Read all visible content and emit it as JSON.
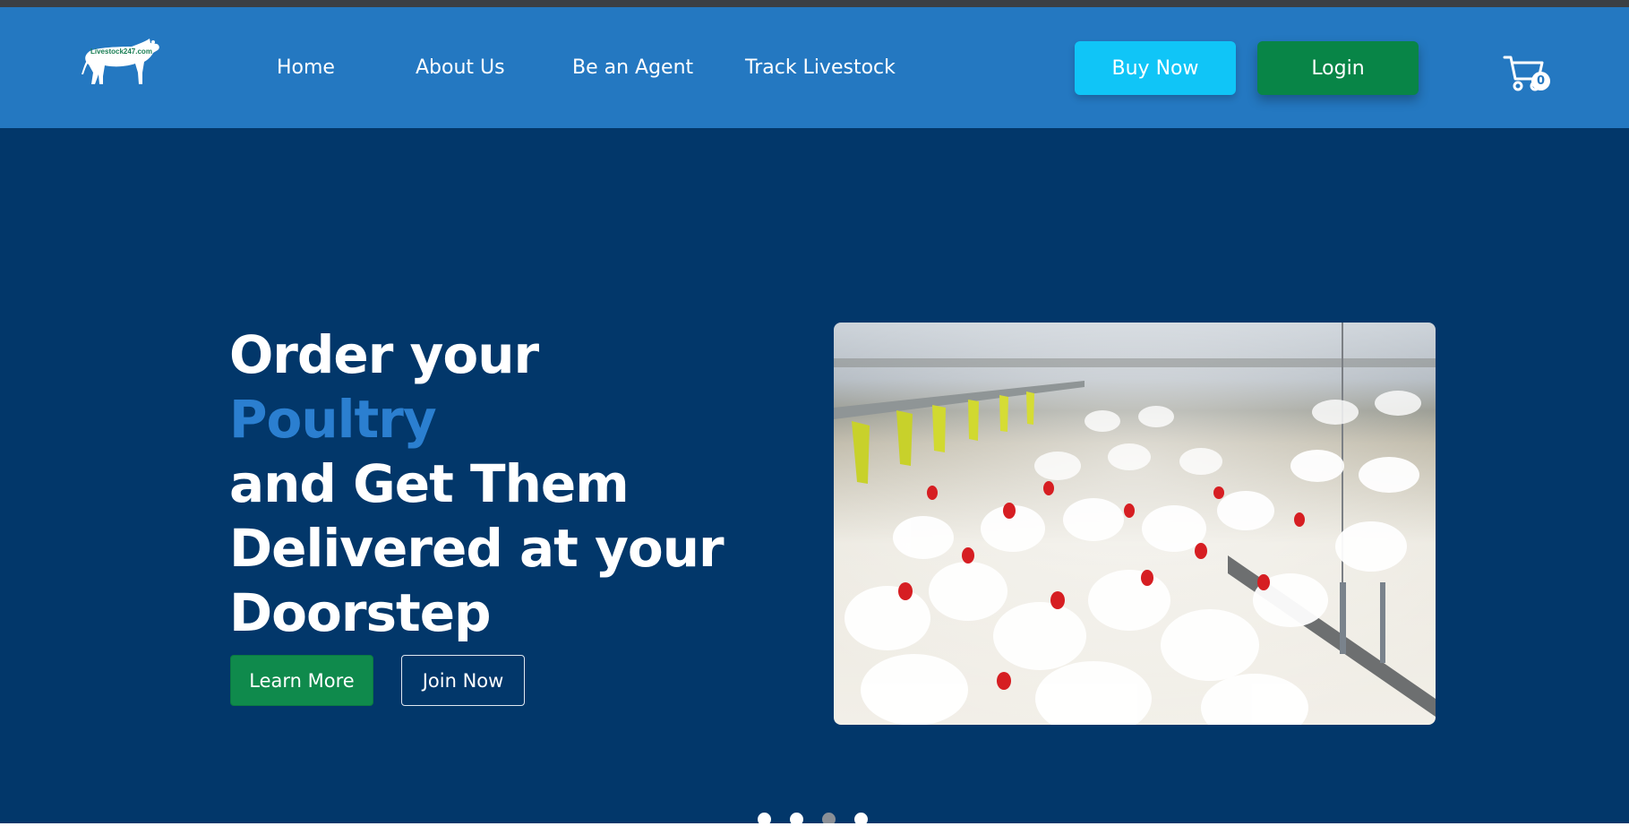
{
  "brand": {
    "logo_text": "Livestock247.com",
    "primary_color": "#2478c1",
    "hero_bg": "#02376a",
    "accent_color": "#2b7fd0",
    "buy_color": "#10c5f7",
    "login_color": "#088547"
  },
  "nav": {
    "items": [
      {
        "label": "Home"
      },
      {
        "label": "About Us"
      },
      {
        "label": "Be an Agent"
      },
      {
        "label": "Track Livestock"
      }
    ]
  },
  "header": {
    "buy_label": "Buy Now",
    "login_label": "Login",
    "cart_icon": "cart-icon",
    "cart_count": "0"
  },
  "hero": {
    "title_part1": "Order your ",
    "title_accent": "Poultry",
    "title_part2": "and Get Them Delivered at your Doorstep",
    "learn_more_label": "Learn More",
    "join_now_label": "Join Now",
    "image_subject": "poultry farm with white chickens"
  },
  "carousel": {
    "slide_count": 4,
    "active_index": 2
  }
}
